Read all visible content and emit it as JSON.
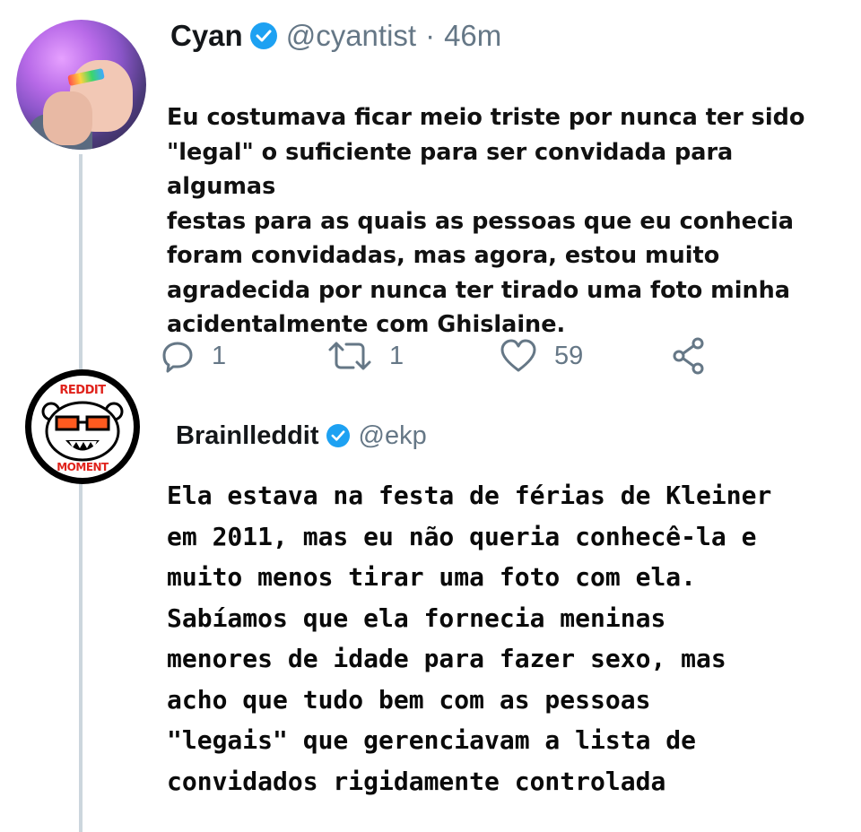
{
  "thread": {
    "tweets": [
      {
        "display_name": "Cyan",
        "handle": "@cyantist",
        "separator": "·",
        "time": "46m",
        "text": "Eu costumava ficar meio triste por nunca ter sido\n\"legal\" o suficiente para ser convidada para algumas\nfestas para as quais as pessoas que eu conhecia\nforam convidadas, mas agora, estou muito\nagradecida por nunca ter tirado uma foto minha\nacidentalmente com Ghislaine.",
        "actions": {
          "reply_count": "1",
          "retweet_count": "1",
          "like_count": "59"
        }
      },
      {
        "display_name": "Brainlleddit",
        "handle": "@ekp",
        "avatar_text_top": "REDDIT",
        "avatar_text_bottom": "MOMENT",
        "text": "Ela estava na festa de férias de Kleiner\nem 2011, mas eu não queria conhecê-la e\nmuito menos tirar uma foto com ela.\nSabíamos que ela fornecia meninas\nmenores de idade para fazer sexo, mas\nacho que tudo bem com as pessoas\n\"legais\" que gerenciavam a lista de\nconvidados rigidamente controlada"
      }
    ]
  },
  "colors": {
    "verified": "#1da1f2",
    "muted": "#657786",
    "thread_line": "#ccd6dd",
    "logo_red": "#e0221b"
  },
  "icons": [
    "reply-icon",
    "retweet-icon",
    "like-icon",
    "share-icon",
    "verified-badge-icon"
  ]
}
